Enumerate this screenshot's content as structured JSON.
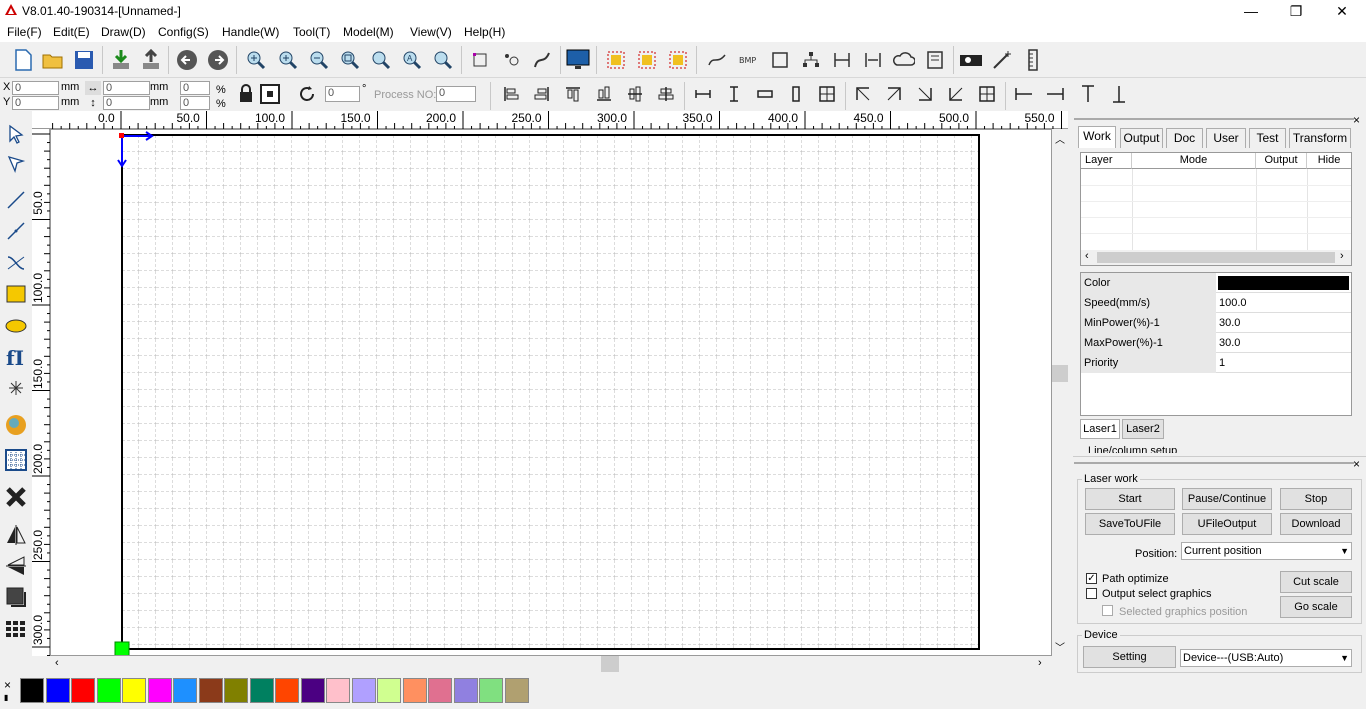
{
  "window": {
    "title": "V8.01.40-190314-[Unnamed-]",
    "minimize": "—",
    "maximize": "❐",
    "close": "✕"
  },
  "menu": [
    "File(F)",
    "Edit(E)",
    "Draw(D)",
    "Config(S)",
    "Handle(W)",
    "Tool(T)",
    "Model(M)",
    "View(V)",
    "Help(H)"
  ],
  "coords": {
    "x_label": "X",
    "y_label": "Y",
    "x_value": "0",
    "y_value": "0",
    "unit": "mm",
    "w_value": "0",
    "h_value": "0",
    "px_value": "0",
    "py_value": "0",
    "percent": "%",
    "rotate_value": "0",
    "degree": "°",
    "process_label": "Process NO:",
    "process_value": "0"
  },
  "ruler": {
    "top_labels": [
      "0.0",
      "50.0",
      "100.0",
      "150.0",
      "200.0",
      "250.0",
      "300.0",
      "350.0",
      "400.0",
      "450.0",
      "500.0",
      "550.0"
    ],
    "left_labels": [
      "50.0",
      "100.0",
      "150.0",
      "200.0",
      "250.0",
      "300.0"
    ]
  },
  "tabs": [
    "Work",
    "Output",
    "Doc",
    "User",
    "Test",
    "Transform"
  ],
  "layer_table": {
    "headers": [
      "Layer",
      "Mode",
      "Output",
      "Hide"
    ]
  },
  "props": [
    {
      "name": "Color",
      "value": ""
    },
    {
      "name": "Speed(mm/s)",
      "value": "100.0"
    },
    {
      "name": "MinPower(%)-1",
      "value": "30.0"
    },
    {
      "name": "MaxPower(%)-1",
      "value": "30.0"
    },
    {
      "name": "Priority",
      "value": "1"
    }
  ],
  "laser_tabs": [
    "Laser1",
    "Laser2"
  ],
  "partial_label": "Line/column setup",
  "laser_work": {
    "title": "Laser work",
    "start": "Start",
    "pause": "Pause/Continue",
    "stop": "Stop",
    "save": "SaveToUFile",
    "ufile": "UFileOutput",
    "download": "Download",
    "position_label": "Position:",
    "position_value": "Current position",
    "path_optimize": "Path optimize",
    "output_select": "Output select graphics",
    "selected_pos": "Selected graphics position",
    "cut_scale": "Cut scale",
    "go_scale": "Go scale"
  },
  "device": {
    "title": "Device",
    "setting": "Setting",
    "device_value": "Device---(USB:Auto)"
  },
  "palette": [
    "#000000",
    "#0000ff",
    "#ff0000",
    "#00ff00",
    "#ffff00",
    "#ff00ff",
    "#1e90ff",
    "#8b3a1a",
    "#808000",
    "#008060",
    "#ff4500",
    "#4b0082",
    "#ffc0cb",
    "#b0a0ff",
    "#d0ff90",
    "#ff9060",
    "#e07090",
    "#9080e0",
    "#80e080",
    "#b0a070"
  ],
  "colors": {
    "layer_color": "#000000",
    "origin_marker": "#00ff00",
    "axis_blue": "#0000ff"
  }
}
